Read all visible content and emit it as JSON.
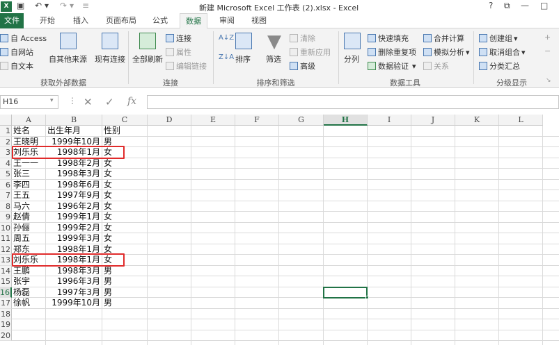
{
  "window": {
    "title": "新建 Microsoft Excel 工作表 (2).xlsx - Excel",
    "logo": "X",
    "help": "?",
    "restore": "⧉",
    "minimize": "—",
    "close": "□"
  },
  "tabs": [
    "文件",
    "开始",
    "插入",
    "页面布局",
    "公式",
    "数据",
    "审阅",
    "视图"
  ],
  "ribbon": {
    "get_external": {
      "access": "自 Access",
      "web": "自网站",
      "text": "自文本",
      "other": "自其他来源",
      "existing": "现有连接",
      "label": "获取外部数据"
    },
    "connections": {
      "refresh_all": "全部刷新",
      "connections": "连接",
      "properties": "属性",
      "edit_links": "编辑链接",
      "label": "连接"
    },
    "sort_filter": {
      "sort": "排序",
      "filter": "筛选",
      "clear": "清除",
      "reapply": "重新应用",
      "advanced": "高级",
      "label": "排序和筛选"
    },
    "data_tools": {
      "text_to_columns": "分列",
      "flash_fill": "快速填充",
      "remove_duplicates": "删除重复项",
      "validation": "数据验证",
      "consolidate": "合并计算",
      "what_if": "模拟分析",
      "relationships": "关系",
      "label": "数据工具"
    },
    "outline": {
      "group": "创建组",
      "ungroup": "取消组合",
      "subtotal": "分类汇总",
      "label": "分级显示"
    }
  },
  "formula_bar": {
    "name_box": "H16",
    "fx": "fx",
    "cancel": "✕",
    "enter": "✓",
    "value": ""
  },
  "columns": [
    "A",
    "B",
    "C",
    "D",
    "E",
    "F",
    "G",
    "H",
    "I",
    "J",
    "K",
    "L"
  ],
  "rows": [
    "1",
    "2",
    "3",
    "4",
    "5",
    "6",
    "7",
    "8",
    "9",
    "10",
    "11",
    "12",
    "13",
    "14",
    "15",
    "16",
    "17",
    "18",
    "19",
    "20"
  ],
  "selected_cell": "H16",
  "sheet": [
    [
      "姓名",
      "出生年月",
      "性别"
    ],
    [
      "王晓明",
      "1999年10月",
      "男"
    ],
    [
      "刘乐乐",
      "1998年1月",
      "女"
    ],
    [
      "王一一",
      "1998年2月",
      "女"
    ],
    [
      "张三",
      "1998年3月",
      "女"
    ],
    [
      "李四",
      "1998年6月",
      "女"
    ],
    [
      "王五",
      "1997年9月",
      "女"
    ],
    [
      "马六",
      "1996年2月",
      "女"
    ],
    [
      "赵倩",
      "1999年1月",
      "女"
    ],
    [
      "孙俪",
      "1999年2月",
      "女"
    ],
    [
      "周五",
      "1999年3月",
      "女"
    ],
    [
      "郑东",
      "1998年1月",
      "女"
    ],
    [
      "刘乐乐",
      "1998年1月",
      "女"
    ],
    [
      "王鹏",
      "1998年3月",
      "男"
    ],
    [
      "张宇",
      "1996年3月",
      "男"
    ],
    [
      "杨磊",
      "1997年3月",
      "男"
    ],
    [
      "徐帆",
      "1999年10月",
      "男"
    ]
  ],
  "highlight_color": "#e02b2b",
  "accent_color": "#217346"
}
